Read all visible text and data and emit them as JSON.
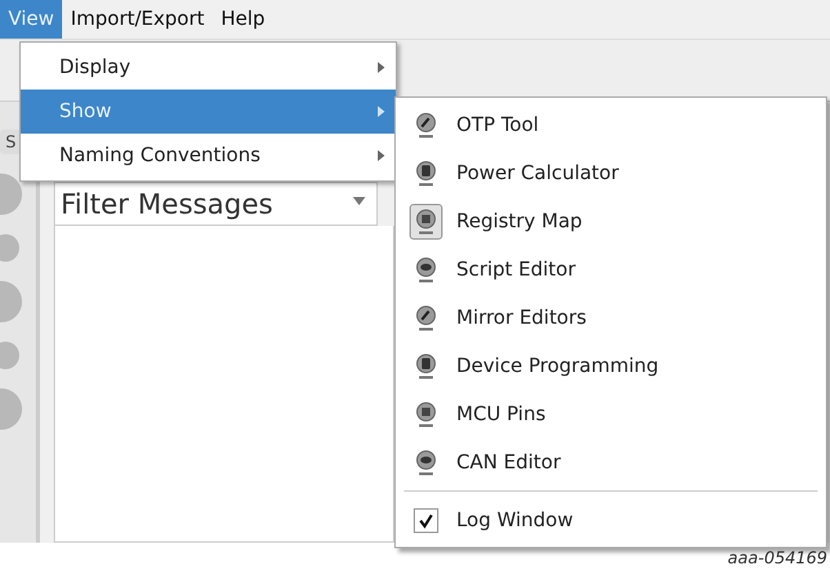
{
  "menubar": [
    {
      "label": "View",
      "selected": true
    },
    {
      "label": "Import/Export",
      "selected": false
    },
    {
      "label": "Help",
      "selected": false
    }
  ],
  "view_menu": [
    {
      "label": "Display",
      "selected": false
    },
    {
      "label": "Show",
      "selected": true
    },
    {
      "label": "Naming Conventions",
      "selected": false
    }
  ],
  "side_tab": "S",
  "filter": {
    "value": "Filter Messages"
  },
  "show_submenu": [
    {
      "kind": "icon",
      "label": "OTP Tool",
      "checked": false
    },
    {
      "kind": "icon",
      "label": "Power Calculator",
      "checked": false
    },
    {
      "kind": "icon",
      "label": "Registry Map",
      "checked": true
    },
    {
      "kind": "icon",
      "label": "Script Editor",
      "checked": false
    },
    {
      "kind": "icon",
      "label": "Mirror Editors",
      "checked": false
    },
    {
      "kind": "icon",
      "label": "Device Programming",
      "checked": false
    },
    {
      "kind": "icon",
      "label": "MCU Pins",
      "checked": false
    },
    {
      "kind": "icon",
      "label": "CAN Editor",
      "checked": false
    },
    {
      "kind": "separator"
    },
    {
      "kind": "check",
      "label": "Log Window",
      "checked": true
    }
  ],
  "figure_id": "aaa-054169"
}
